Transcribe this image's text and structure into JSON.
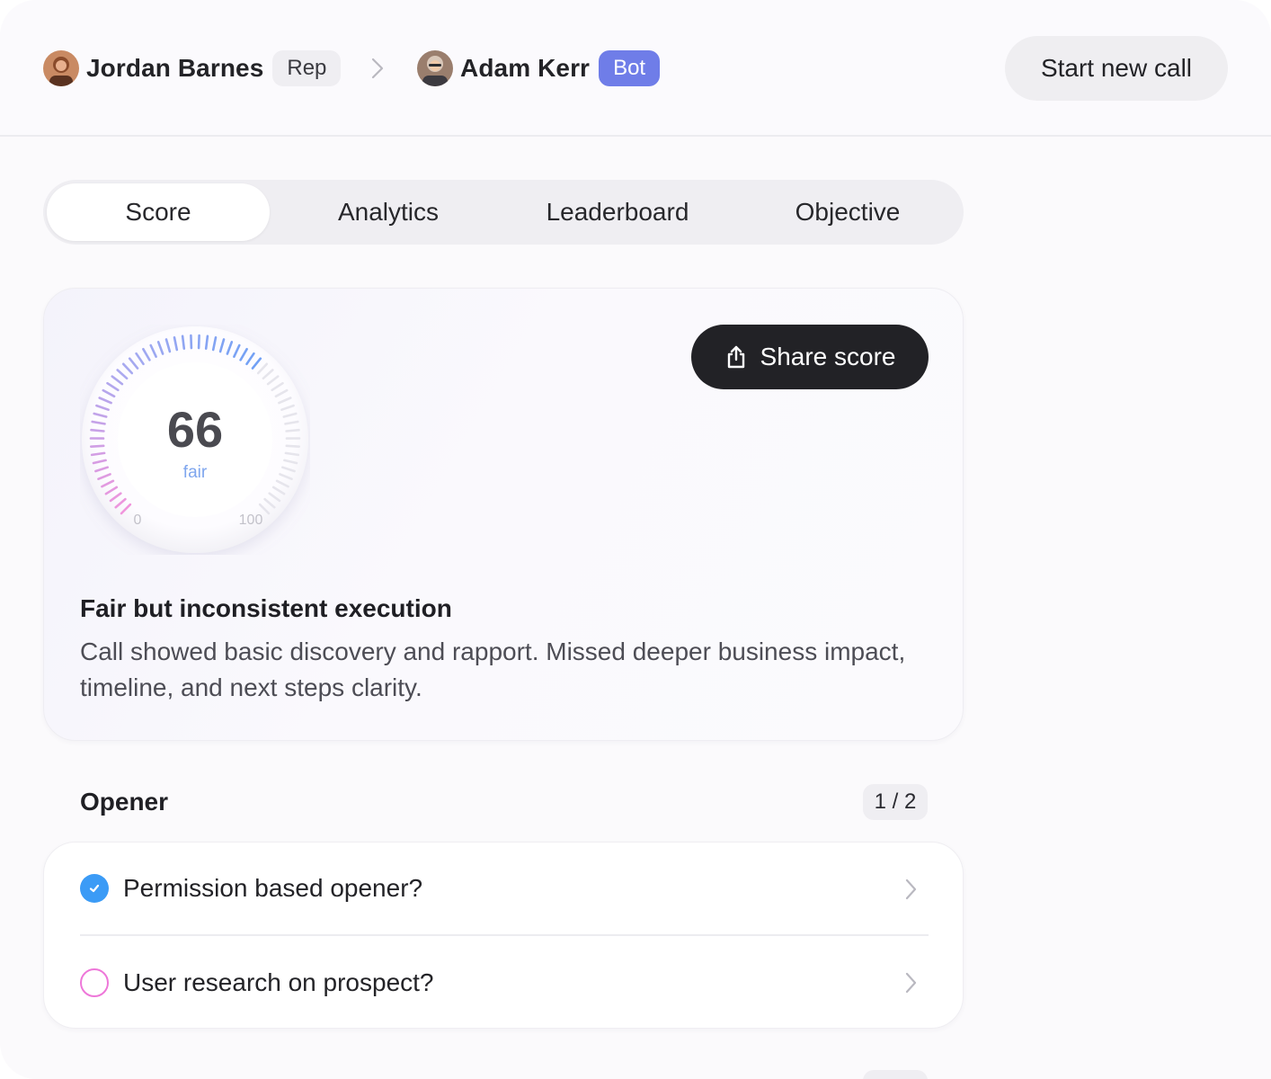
{
  "header": {
    "rep": {
      "name": "Jordan Barnes",
      "role": "Rep"
    },
    "bot": {
      "name": "Adam Kerr",
      "role": "Bot"
    },
    "start_button": "Start new call"
  },
  "tabs": [
    {
      "label": "Score",
      "active": true
    },
    {
      "label": "Analytics",
      "active": false
    },
    {
      "label": "Leaderboard",
      "active": false
    },
    {
      "label": "Objective",
      "active": false
    }
  ],
  "score": {
    "value": "66",
    "grade": "fair",
    "scale_min": "0",
    "scale_max": "100",
    "share_button": "Share score",
    "verdict_title": "Fair but inconsistent execution",
    "verdict_body": "Call showed basic discovery and rapport. Missed deeper business impact, timeline, and next steps clarity."
  },
  "section": {
    "title": "Opener",
    "count": "1 / 2",
    "items": [
      {
        "label": "Permission based opener?",
        "checked": true
      },
      {
        "label": "User research on prospect?",
        "checked": false
      }
    ]
  },
  "colors": {
    "accent_blue": "#3b9bf6",
    "bot_chip": "#6f7de8",
    "pending_pink": "#ee77d9",
    "dark_button": "#222226"
  },
  "icons": {
    "separator": "chevron-right-icon",
    "share": "share-icon",
    "row_chevron": "chevron-right-icon",
    "checked": "check-circle-icon",
    "unchecked": "circle-icon"
  }
}
